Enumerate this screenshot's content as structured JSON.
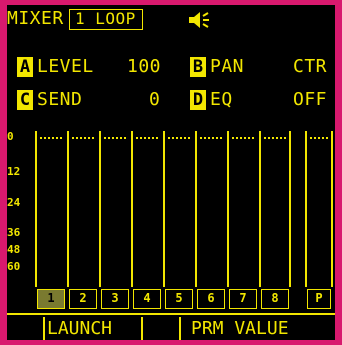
{
  "header": {
    "title": "MIXER",
    "mode_label": "1 LOOP",
    "speaker_icon": "speaker-icon"
  },
  "params": {
    "a": {
      "key": "A",
      "name": "LEVEL",
      "value": "100"
    },
    "b": {
      "key": "B",
      "name": "PAN",
      "value": "CTR"
    },
    "c": {
      "key": "C",
      "name": "SEND",
      "value": "0"
    },
    "d": {
      "key": "D",
      "name": "EQ",
      "value": "OFF"
    }
  },
  "meter_scale": [
    "0",
    "12",
    "24",
    "36",
    "48",
    "60"
  ],
  "channels": [
    "1",
    "2",
    "3",
    "4",
    "5",
    "6",
    "7",
    "8"
  ],
  "selected_channel": "1",
  "master_label": "P",
  "softkeys": {
    "left": "LAUNCH",
    "right": "PRM VALUE"
  },
  "colors": {
    "text": "#f2e600",
    "background": "#000000",
    "bezel": "#d8196e"
  }
}
